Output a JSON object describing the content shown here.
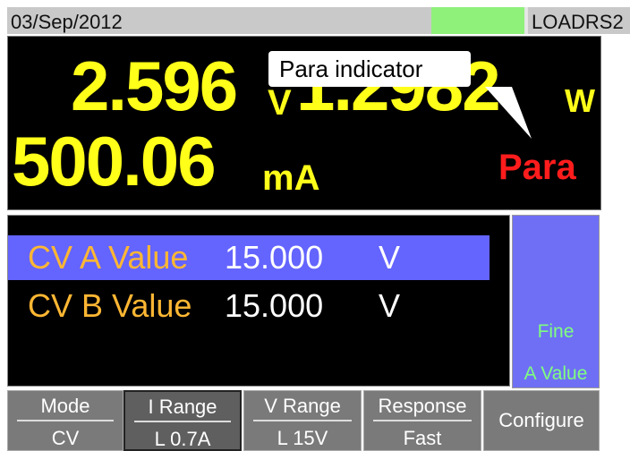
{
  "status": {
    "date": "03/Sep/2012",
    "name": "LOADRS2",
    "indicator_color": "#8ff07a"
  },
  "measurement": {
    "voltage": "2.596",
    "voltage_unit": "V",
    "power": "1.2982",
    "power_unit": "W",
    "current": "500.06",
    "current_unit": "mA",
    "state": "Para",
    "callout": "Para indicator"
  },
  "settings": [
    {
      "label": "CV A Value",
      "value": "15.000",
      "unit": "V",
      "selected": true
    },
    {
      "label": "CV B Value",
      "value": "15.000",
      "unit": "V",
      "selected": false
    }
  ],
  "side_key": {
    "line1": "Fine",
    "line2": "A Value"
  },
  "softkeys": [
    {
      "top": "Mode",
      "bottom": "CV"
    },
    {
      "top": "I Range",
      "bottom": "L 0.7A"
    },
    {
      "top": "V Range",
      "bottom": "L 15V"
    },
    {
      "top": "Response",
      "bottom": "Fast"
    },
    {
      "label": "Configure"
    }
  ],
  "colors": {
    "readout": "#ffff1a",
    "para": "#ff1c1c",
    "selection": "#6464ff",
    "label": "#ffb733"
  }
}
